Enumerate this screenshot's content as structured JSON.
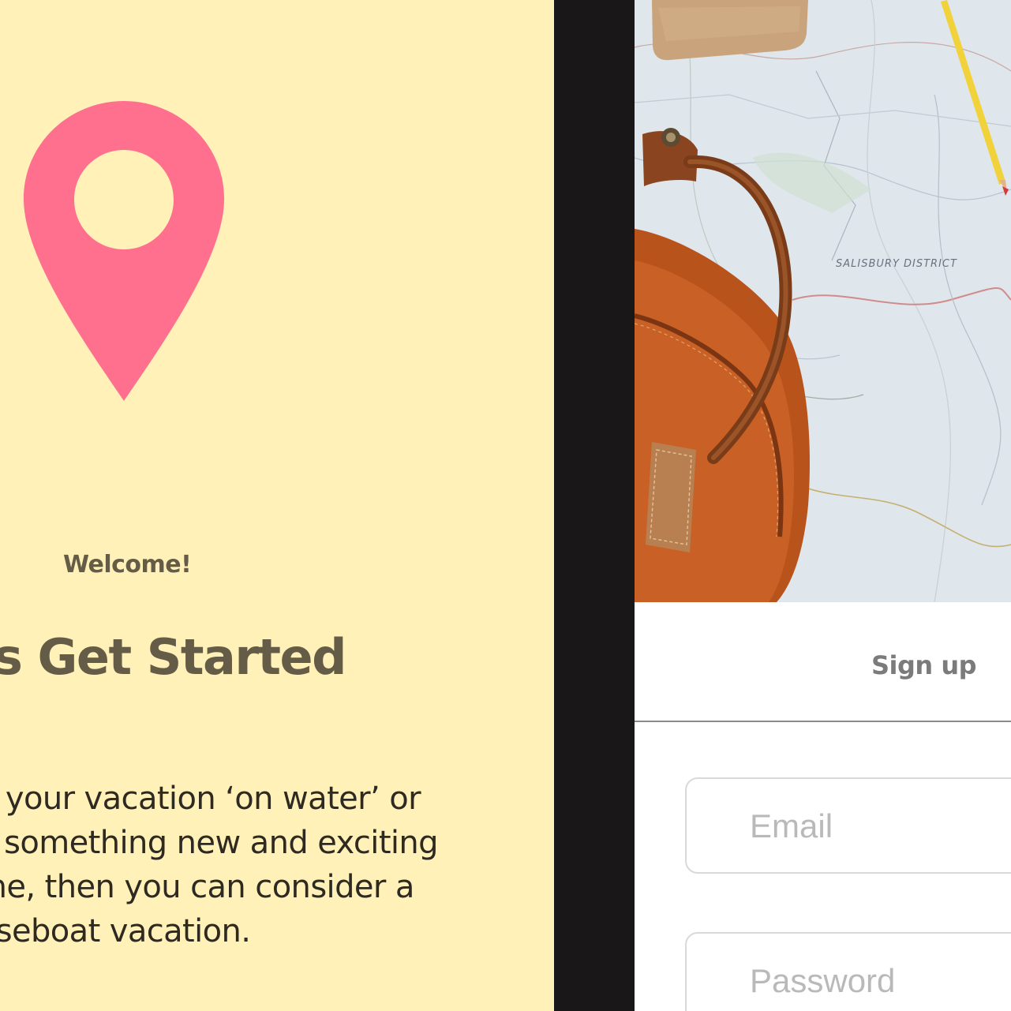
{
  "left_screen": {
    "welcome": "Welcome!",
    "headline": "’s Get Started",
    "body": "g your vacation ‘on water’ or\ny something new and exciting\nme, then you can consider a\nuseboat vacation.",
    "pin_icon": "map-pin-icon",
    "colors": {
      "background": "#fff1b8",
      "pin": "#ff6f8e",
      "heading": "#645c47",
      "body": "#2e2a22"
    }
  },
  "right_screen": {
    "hero": {
      "map_label": "SALISBURY DISTRICT"
    },
    "signup": {
      "title": "Sign up"
    },
    "fields": {
      "email_placeholder": "Email",
      "password_placeholder": "Password"
    },
    "colors": {
      "title": "#7b7b7b",
      "divider": "#8a8a8a",
      "field_border": "#d9d9d9",
      "placeholder": "#b9b9b9"
    }
  }
}
